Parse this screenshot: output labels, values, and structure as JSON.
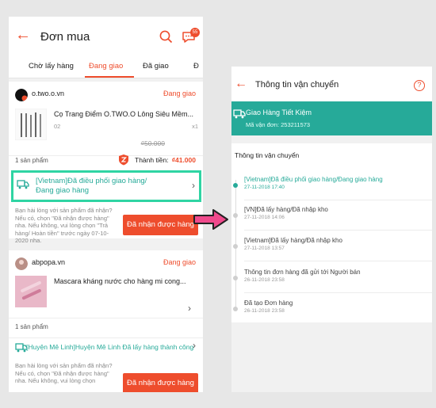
{
  "left": {
    "header": {
      "title": "Đơn mua",
      "badge": "55"
    },
    "tabs": [
      "Chờ lấy hàng",
      "Đang giao",
      "Đã giao",
      "Đ"
    ],
    "order1": {
      "shop": "o.two.o.vn",
      "status": "Đang giao",
      "product": "Cọ Trang Điểm O.TWO.O Lông Siêu Mềm...",
      "variant": "02",
      "qty": "x1",
      "price": "₫50.000",
      "count": "1 sản phẩm",
      "total_label": "Thành tiền:",
      "total_value": "₫41.000",
      "shipping": "[Vietnam]Đã điều phối giao hàng/Đang giao hàng",
      "note": "Bạn hài lòng với sản phẩm đã nhận? Nếu có, chọn \"Đã nhận được hàng\" nha. Nếu không, vui lòng chọn \"Trả hàng/ Hoàn tiền\" trước ngày 07-10-2020 nha.",
      "button": "Đã nhận được hàng"
    },
    "order2": {
      "shop": "abpopa.vn",
      "status": "Đang giao",
      "product": "Mascara kháng nước cho hàng mi cong...",
      "count": "1 sản phẩm",
      "shipping": "[Huyện Mê Linh]Huyện Mê Linh Đã lấy hàng thành công",
      "note": "Bạn hài lòng với sản phẩm đã nhận? Nếu có, chọn \"Đã nhận được hàng\" nha. Nếu không, vui lòng chọn",
      "button": "Đã nhận được hàng"
    }
  },
  "right": {
    "header": {
      "title": "Thông tin vận chuyển",
      "help": "?"
    },
    "banner": {
      "carrier": "Giao Hàng Tiết Kiệm",
      "tracking": "Mã vận đơn: 253211573"
    },
    "section_title": "Thông tin vận chuyển",
    "events": [
      {
        "text": "[Vietnam]Đã điều phối giao hàng/Đang giao hàng",
        "time": "27-11-2018 17:40",
        "active": true
      },
      {
        "text": "[VN]Đã lấy hàng/Đã nhập kho",
        "time": "27-11-2018 14:06",
        "active": false
      },
      {
        "text": "[Vietnam]Đã lấy hàng/Đã nhập kho",
        "time": "27-11-2018 13:57",
        "active": false
      },
      {
        "text": "Thông tin đơn hàng đã gửi tới Người bán",
        "time": "26-11-2018 23:58",
        "active": false
      },
      {
        "text": "Đã tạo Đơn hàng",
        "time": "26-11-2018 23:58",
        "active": false
      }
    ]
  },
  "colors": {
    "accent": "#ee4d2d",
    "teal": "#26aa99",
    "highlight": "#2fd4a3",
    "arrow": "#f04a8c"
  },
  "icons": [
    "back-arrow-icon",
    "search-icon",
    "chat-icon",
    "shield-icon",
    "truck-icon",
    "chevron-right-icon",
    "help-icon",
    "pink-arrow-icon"
  ]
}
